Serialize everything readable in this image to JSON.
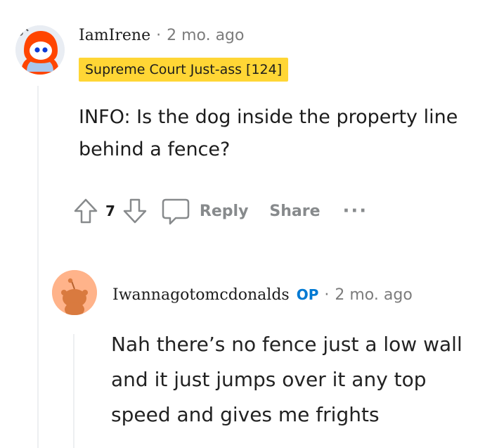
{
  "comment": {
    "username": "IamIrene",
    "separator": "·",
    "timestamp": "2 mo. ago",
    "flair": "Supreme Court Just-ass [124]",
    "body": "INFO: Is the dog inside the property line behind a fence?",
    "score": "7",
    "reply_label": "Reply",
    "share_label": "Share",
    "more_label": "···",
    "avatar_icon": "hooded-snoo-avatar",
    "colors": {
      "flair_bg": "#ffd635",
      "avatar_hood": "#ff4500"
    }
  },
  "reply": {
    "username": "Iwannagotomcdonalds",
    "op_badge": "OP",
    "separator": "·",
    "timestamp": "2 mo. ago",
    "body": "Nah there’s no fence just a low wall and it just jumps over it any top speed and gives me frights",
    "avatar_icon": "default-snoo-avatar",
    "colors": {
      "op_badge": "#0079d3",
      "avatar_bg": "#ffb38a"
    }
  }
}
